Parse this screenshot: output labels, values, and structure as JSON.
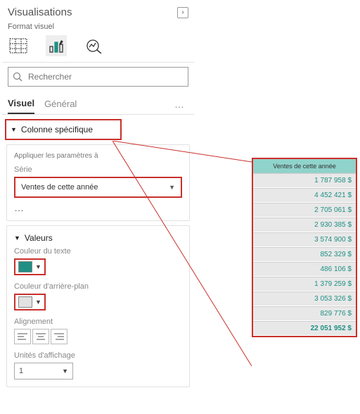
{
  "header": {
    "title": "Visualisations"
  },
  "subheader": "Format visuel",
  "search": {
    "placeholder": "Rechercher"
  },
  "tabs": {
    "active": "Visuel",
    "inactive": "Général"
  },
  "specific_column": {
    "label": "Colonne spécifique"
  },
  "apply": {
    "title": "Appliquer les paramètres à",
    "series_label": "Série",
    "series_value": "Ventes de cette année"
  },
  "values": {
    "title": "Valeurs",
    "text_color_label": "Couleur du texte",
    "text_color": "#1f8f84",
    "bg_color_label": "Couleur d'arrière-plan",
    "bg_color": "#e2e2e2",
    "alignment_label": "Alignement",
    "units_label": "Unités d'affichage",
    "units_value": "1"
  },
  "preview": {
    "header": "Ventes de cette année",
    "rows": [
      "1 787 958 $",
      "4 452 421 $",
      "2 705 061 $",
      "2 930 385 $",
      "3 574 900 $",
      "852 329 $",
      "486 106 $",
      "1 379 259 $",
      "3 053 326 $",
      "829 776 $",
      "22 051 952 $"
    ]
  }
}
